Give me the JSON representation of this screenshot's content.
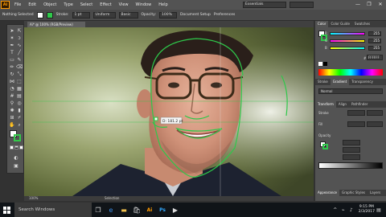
{
  "app": {
    "logo": "Ai"
  },
  "menu": [
    "File",
    "Edit",
    "Object",
    "Type",
    "Select",
    "Effect",
    "View",
    "Window",
    "Help"
  ],
  "workspace": {
    "selected": "Essentials"
  },
  "window_controls": [
    "—",
    "❐",
    "✕"
  ],
  "control_bar": {
    "selection_label": "Nothing Selected",
    "stroke_label": "Stroke:",
    "stroke_value": "1 pt",
    "style_label": "Uniform",
    "brush_label": "Basic",
    "opacity_label": "Opacity:",
    "opacity_value": "100%",
    "document_setup": "Document Setup",
    "preferences": "Preferences"
  },
  "document": {
    "tab_title": "Ai* @ 100% (RGB/Preview)",
    "zoom": "100%",
    "status": "Selection"
  },
  "canvas": {
    "measure_label": "D: 181.2 pt",
    "accent": "#2ec84a"
  },
  "panels": {
    "color_tabs": [
      "Color",
      "Color Guide",
      "Swatches"
    ],
    "color_channels": [
      {
        "name": "R",
        "value": "255"
      },
      {
        "name": "G",
        "value": "255"
      },
      {
        "name": "B",
        "value": "255"
      }
    ],
    "hex_value": "FFFFFF",
    "stroke_tabs": [
      "Stroke",
      "Gradient",
      "Transparency"
    ],
    "normal_mode": "Normal",
    "transform_tabs": [
      "Transform",
      "Align",
      "Pathfinder"
    ],
    "transform_labels": [
      "Stroke",
      "Fill",
      "Opacity"
    ],
    "bottom_tabs": [
      "Appearance",
      "Graphic Styles",
      "Layers"
    ]
  },
  "taskbar": {
    "search_placeholder": "Search Windows",
    "time": "9:15 PM",
    "date": "2/3/2017"
  }
}
